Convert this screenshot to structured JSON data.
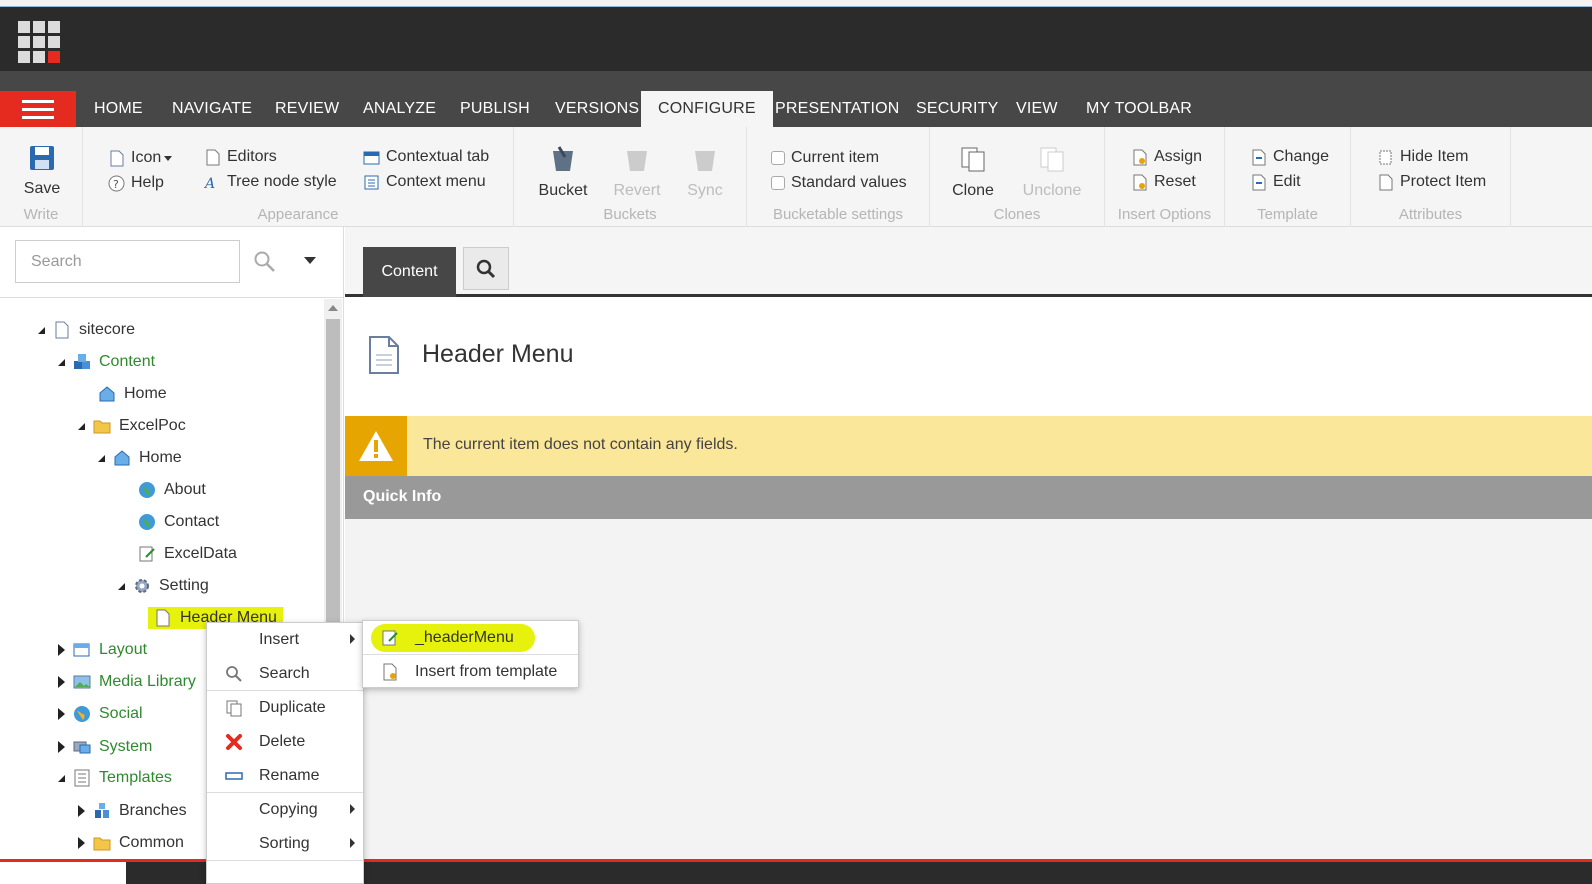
{
  "ribbon_tabs": [
    "HOME",
    "NAVIGATE",
    "REVIEW",
    "ANALYZE",
    "PUBLISH",
    "VERSIONS",
    "CONFIGURE",
    "PRESENTATION",
    "SECURITY",
    "VIEW",
    "MY TOOLBAR"
  ],
  "active_tab": "CONFIGURE",
  "ribbon": {
    "write": {
      "label": "Write",
      "save": "Save"
    },
    "appearance": {
      "label": "Appearance",
      "icon": "Icon",
      "help": "Help",
      "editors": "Editors",
      "tree_node_style": "Tree node style",
      "contextual_tab": "Contextual tab",
      "context_menu": "Context menu"
    },
    "buckets": {
      "label": "Buckets",
      "bucket": "Bucket",
      "revert": "Revert",
      "sync": "Sync"
    },
    "bucketable": {
      "label": "Bucketable settings",
      "current_item": "Current item",
      "standard_values": "Standard values"
    },
    "clones": {
      "label": "Clones",
      "clone": "Clone",
      "unclone": "Unclone"
    },
    "insert_options": {
      "label": "Insert Options",
      "assign": "Assign",
      "reset": "Reset"
    },
    "template": {
      "label": "Template",
      "change": "Change",
      "edit": "Edit"
    },
    "attributes": {
      "label": "Attributes",
      "hide_item": "Hide Item",
      "protect_item": "Protect Item"
    }
  },
  "sidebar": {
    "search_placeholder": "Search",
    "tree": {
      "sitecore": "sitecore",
      "content": "Content",
      "home": "Home",
      "excelpoc": "ExcelPoc",
      "home2": "Home",
      "about": "About",
      "contact": "Contact",
      "exceldata": "ExcelData",
      "setting": "Setting",
      "header_menu": "Header Menu",
      "layout": "Layout",
      "media_library": "Media Library",
      "social": "Social",
      "system": "System",
      "templates": "Templates",
      "branches": "Branches",
      "common": "Common"
    }
  },
  "editor": {
    "content_tab": "Content",
    "item_title": "Header Menu",
    "warning": "The current item does not contain any fields.",
    "quick_info": "Quick Info"
  },
  "context_menu": {
    "insert": "Insert",
    "search": "Search",
    "duplicate": "Duplicate",
    "delete": "Delete",
    "rename": "Rename",
    "copying": "Copying",
    "sorting": "Sorting"
  },
  "submenu": {
    "header_menu_template": "_headerMenu",
    "insert_from_template": "Insert from template"
  },
  "colors": {
    "accent_red": "#e52b20",
    "highlight": "#e6f20c",
    "warning": "#fbe79a"
  }
}
